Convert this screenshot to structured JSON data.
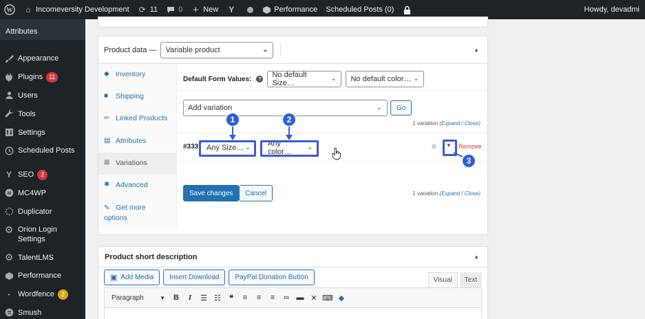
{
  "adminbar": {
    "site_name": "Incomeversity Development",
    "updates_count": "11",
    "comments_count": "0",
    "new_label": "New",
    "performance_label": "Performance",
    "scheduled_posts_label": "Scheduled Posts (0)",
    "howdy": "Howdy, devadmi"
  },
  "sidebar": {
    "current_sub": "Attributes",
    "items": [
      {
        "label": "Appearance",
        "icon": "paintbrush-icon"
      },
      {
        "label": "Plugins",
        "badge": "11",
        "icon": "plugin-icon"
      },
      {
        "label": "Users",
        "icon": "users-icon"
      },
      {
        "label": "Tools",
        "icon": "wrench-icon"
      },
      {
        "label": "Settings",
        "icon": "settings-icon"
      },
      {
        "label": "Scheduled Posts",
        "icon": "clock-icon"
      },
      {
        "label": "SEO",
        "badge": "2",
        "icon": "yoast-icon"
      },
      {
        "label": "MC4WP",
        "icon": "mc4wp-icon"
      },
      {
        "label": "Duplicator",
        "icon": "duplicator-icon"
      },
      {
        "label": "Orion Login",
        "label2": "Settings",
        "icon": "gear-icon"
      },
      {
        "label": "TalentLMS",
        "icon": "gear-icon"
      },
      {
        "label": "Performance",
        "icon": "performance-icon"
      },
      {
        "label": "Wordfence",
        "badge": "2",
        "icon": "wordfence-icon"
      },
      {
        "label": "Smush",
        "icon": "smush-icon"
      }
    ]
  },
  "product_data": {
    "title": "Product data —",
    "type_select": "Variable product",
    "tabs": [
      "Inventory",
      "Shipping",
      "Linked Products",
      "Attributes",
      "Variations",
      "Advanced",
      "Get more",
      "options"
    ],
    "default_form_label": "Default Form Values:",
    "default_size": "No default Size…",
    "default_color": "No default color…",
    "add_variation": "Add variation",
    "go_label": "Go",
    "variation_count": "1 variation (",
    "expand": "Expand",
    "slash": " / ",
    "close": "Close",
    "close_paren": ")",
    "variation_id": "#333",
    "any_size": "Any Size…",
    "any_color": "Any color…",
    "remove": "Remove",
    "save_changes": "Save changes",
    "cancel": "Cancel"
  },
  "callouts": [
    "1",
    "2",
    "3"
  ],
  "short_desc": {
    "title": "Product short description",
    "add_media": "Add Media",
    "insert_download": "Insert Download",
    "paypal": "PayPal Donation Button",
    "visual": "Visual",
    "text": "Text",
    "paragraph": "Paragraph"
  },
  "colors": {
    "accent": "#2271b1",
    "callout": "#2e5fd8",
    "danger": "#d63638",
    "adminbar": "#1d2327"
  }
}
